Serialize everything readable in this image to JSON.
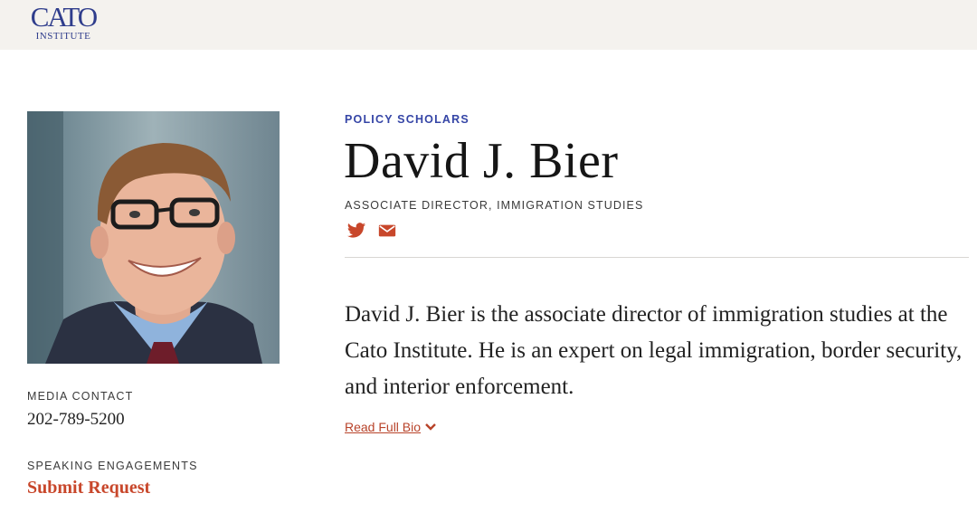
{
  "header": {
    "logo_main": "CATO",
    "logo_sub": "INSTITUTE",
    "brand_color": "#2f3d8c",
    "background": "#f4f2ee"
  },
  "profile": {
    "photo": "portrait-photo",
    "media_contact_label": "MEDIA CONTACT",
    "media_contact_phone": "202-789-5200",
    "speaking_label": "SPEAKING ENGAGEMENTS",
    "speaking_link": "Submit Request",
    "category": "POLICY SCHOLARS",
    "name": "David J. Bier",
    "job_title": "ASSOCIATE DIRECTOR, IMMIGRATION STUDIES",
    "social_icons": [
      "twitter-icon",
      "email-icon"
    ],
    "bio": "David J. Bier is the associate director of immigration studies at the Cato Institute. He is an expert on legal immigration, border security, and interior enforcement.",
    "read_more": "Read Full Bio",
    "accent_color": "#c8472b",
    "category_color": "#3545a6"
  }
}
